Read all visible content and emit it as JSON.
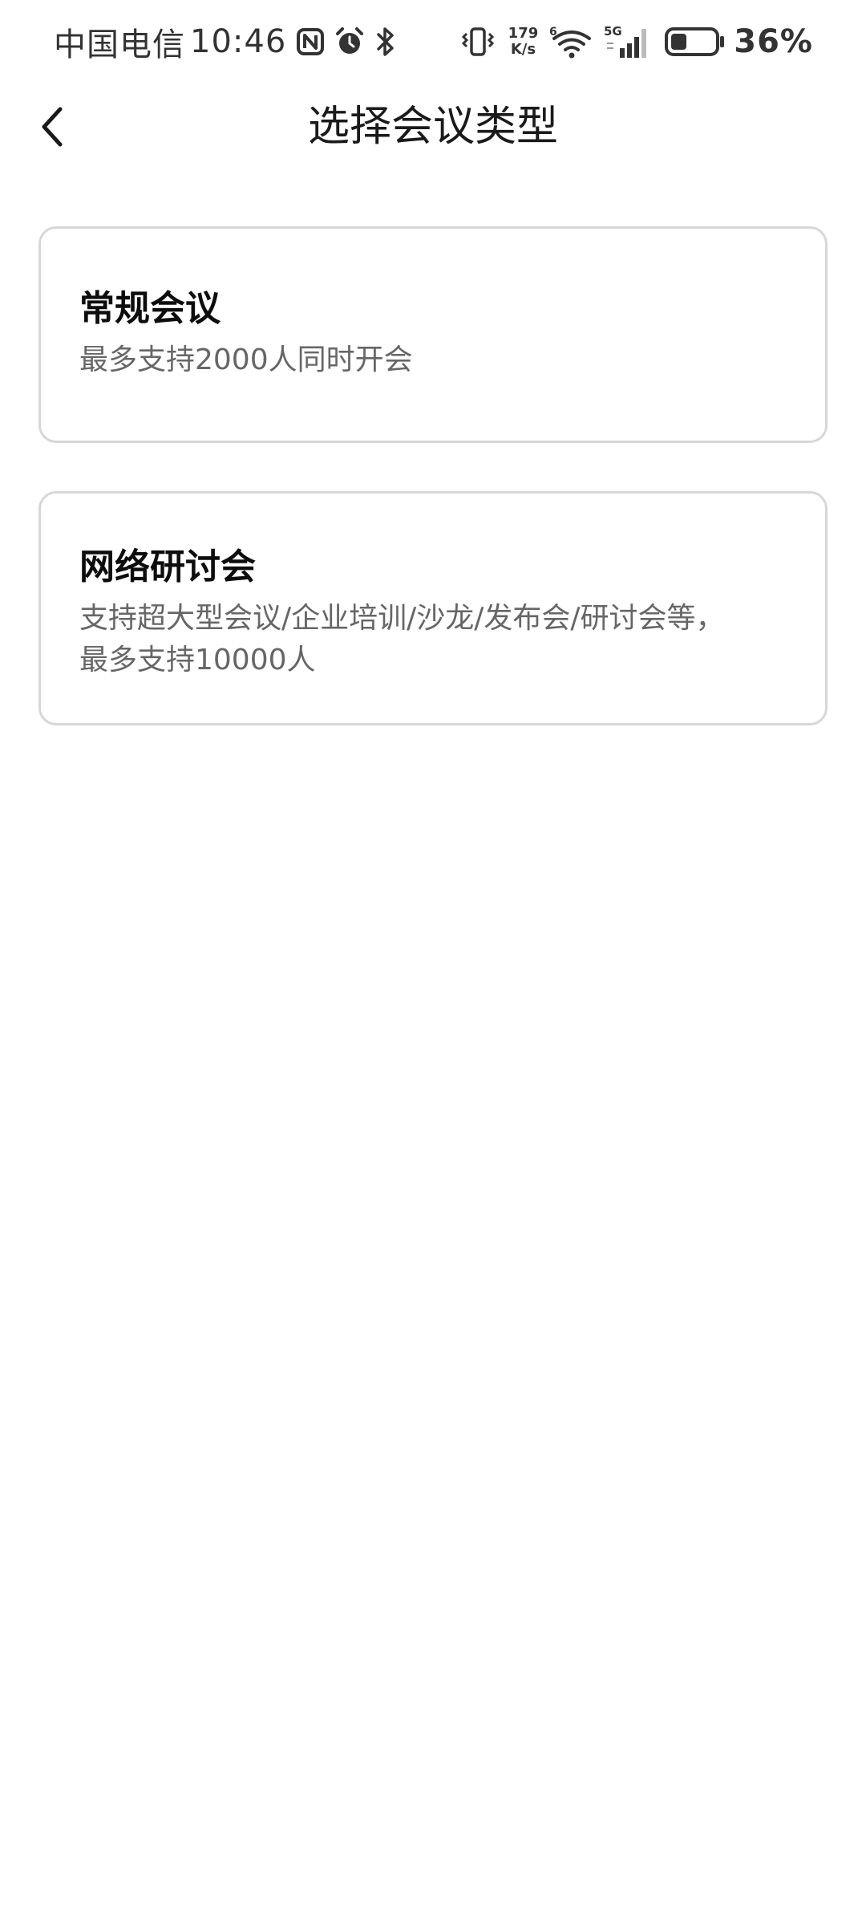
{
  "status_bar": {
    "carrier": "中国电信",
    "time": "10:46",
    "network_speed_value": "179",
    "network_speed_unit": "K/s",
    "wifi_badge": "6",
    "cellular_badge": "5G",
    "battery_percent": "36%",
    "battery_level": 0.36,
    "icons": [
      "nfc-icon",
      "alarm-icon",
      "bluetooth-icon",
      "vibrate-icon",
      "wifi-icon",
      "signal-icon",
      "battery-icon"
    ]
  },
  "header": {
    "title": "选择会议类型",
    "back_icon": "chevron-left-icon"
  },
  "meeting_types": [
    {
      "title": "常规会议",
      "description": "最多支持2000人同时开会"
    },
    {
      "title": "网络研讨会",
      "description_line1": "支持超大型会议/企业培训/沙龙/发布会/研讨会等，",
      "description_line2": "最多支持10000人"
    }
  ],
  "colors": {
    "card_border": "#d7d7d7",
    "title_text": "#0d0d0d",
    "description_text": "#666666",
    "background": "#ffffff"
  }
}
